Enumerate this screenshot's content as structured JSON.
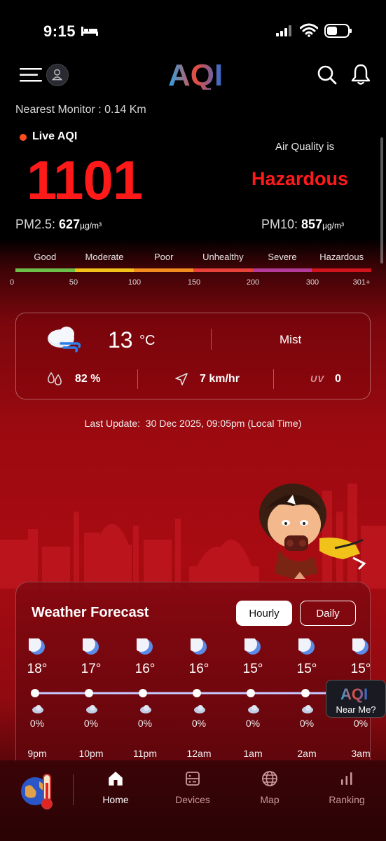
{
  "status_bar": {
    "time": "9:15"
  },
  "header": {
    "logo_text": "AQI",
    "nearest_monitor": "Nearest Monitor : 0.14 Km"
  },
  "aqi": {
    "live_label": "Live AQI",
    "value": "1101",
    "air_quality_label": "Air Quality is",
    "status": "Hazardous",
    "status_color": "#ff1a1a",
    "pm25_label": "PM2.5:",
    "pm25_value": "627",
    "pm25_unit": "µg/m³",
    "pm10_label": "PM10:",
    "pm10_value": "857",
    "pm10_unit": "µg/m³"
  },
  "scale": {
    "labels": [
      "Good",
      "Moderate",
      "Poor",
      "Unhealthy",
      "Severe",
      "Hazardous"
    ],
    "colors": [
      "#6cc04a",
      "#f2c21a",
      "#f28c1e",
      "#e8413a",
      "#b43a9a",
      "#d0141c"
    ],
    "ticks": [
      "0",
      "50",
      "100",
      "150",
      "200",
      "300",
      "301+"
    ]
  },
  "weather": {
    "temperature": "13",
    "temp_unit": "°C",
    "condition": "Mist",
    "humidity": "82 %",
    "wind": "7 km/hr",
    "uv_label": "UV",
    "uv_value": "0",
    "icon": "cloud-wind-icon"
  },
  "last_update": {
    "label": "Last Update:",
    "value": "30 Dec 2025, 09:05pm (Local Time)"
  },
  "forecast": {
    "title": "Weather Forecast",
    "tab_hourly": "Hourly",
    "tab_daily": "Daily",
    "selected_tab": "Hourly",
    "hours": [
      {
        "time": "9pm",
        "temp": "18°",
        "rain": "0%"
      },
      {
        "time": "10pm",
        "temp": "17°",
        "rain": "0%"
      },
      {
        "time": "11pm",
        "temp": "16°",
        "rain": "0%"
      },
      {
        "time": "12am",
        "temp": "16°",
        "rain": "0%"
      },
      {
        "time": "1am",
        "temp": "15°",
        "rain": "0%"
      },
      {
        "time": "2am",
        "temp": "15°",
        "rain": "0%"
      },
      {
        "time": "3am",
        "temp": "15°",
        "rain": "0%"
      }
    ]
  },
  "near_me": {
    "logo": "AQI",
    "label": "Near Me?"
  },
  "nav": {
    "items": [
      {
        "label": "Home",
        "icon": "home-icon",
        "active": true
      },
      {
        "label": "Devices",
        "icon": "devices-icon",
        "active": false
      },
      {
        "label": "Map",
        "icon": "globe-icon",
        "active": false
      },
      {
        "label": "Ranking",
        "icon": "ranking-icon",
        "active": false
      }
    ]
  }
}
